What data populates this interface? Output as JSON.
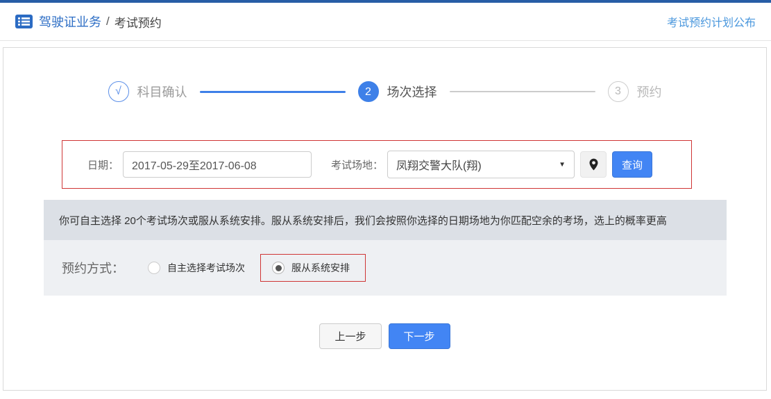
{
  "colors": {
    "accent_blue": "#4285f4",
    "step_blue": "#3e80e8",
    "breadcrumb_blue": "#2d6ec5",
    "link_blue": "#4a97dd",
    "alert_red": "#cf3434",
    "notice_bg": "#dce0e6",
    "booking_bg": "#eef0f3",
    "topbar_blue": "#275da6"
  },
  "header": {
    "breadcrumb_root": "驾驶证业务",
    "breadcrumb_sep": "/",
    "breadcrumb_current": "考试预约",
    "link": "考试预约计划公布"
  },
  "stepper": {
    "steps": [
      {
        "symbol": "√",
        "label": "科目确认",
        "state": "done"
      },
      {
        "symbol": "2",
        "label": "场次选择",
        "state": "active"
      },
      {
        "symbol": "3",
        "label": "预约",
        "state": "pending"
      }
    ]
  },
  "search": {
    "date_label": "日期：",
    "date_value": "2017-05-29至2017-06-08",
    "venue_label": "考试场地：",
    "venue_value": "凤翔交警大队(翔)",
    "query_button": "查询"
  },
  "icons": {
    "dropdown_arrow": "▼"
  },
  "notice": {
    "text": "你可自主选择 20个考试场次或服从系统安排。服从系统安排后，我们会按照你选择的日期场地为你匹配空余的考场，选上的概率更高"
  },
  "booking": {
    "label": "预约方式：",
    "options": [
      {
        "label": "自主选择考试场次",
        "checked": false
      },
      {
        "label": "服从系统安排",
        "checked": true
      }
    ]
  },
  "footer": {
    "prev": "上一步",
    "next": "下一步"
  }
}
